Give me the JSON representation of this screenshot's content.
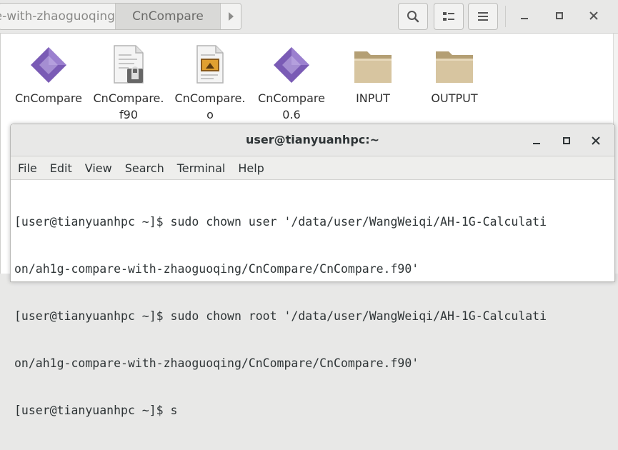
{
  "file_manager": {
    "breadcrumbs": [
      "pare-with-zhaoguoqing",
      "CnCompare"
    ],
    "buttons": [
      "search-icon",
      "view-toggle-icon",
      "menu-icon"
    ],
    "window_controls": [
      "minimize",
      "maximize",
      "close"
    ],
    "files": [
      {
        "name_line1": "CnCompare",
        "name_line2": "",
        "icon": "executable-icon"
      },
      {
        "name_line1": "CnCompare.",
        "name_line2": "f90",
        "icon": "text-file-locked-icon"
      },
      {
        "name_line1": "CnCompare.",
        "name_line2": "o",
        "icon": "object-file-icon"
      },
      {
        "name_line1": "CnCompare",
        "name_line2": "0.6",
        "icon": "executable-icon"
      },
      {
        "name_line1": "INPUT",
        "name_line2": "",
        "icon": "folder-icon"
      },
      {
        "name_line1": "OUTPUT",
        "name_line2": "",
        "icon": "folder-icon"
      }
    ]
  },
  "terminal": {
    "title": "user@tianyuanhpc:~",
    "menu": [
      "File",
      "Edit",
      "View",
      "Search",
      "Terminal",
      "Help"
    ],
    "lines": [
      "[user@tianyuanhpc ~]$ sudo chown user '/data/user/WangWeiqi/AH-1G-Calculati",
      "on/ah1g-compare-with-zhaoguoqing/CnCompare/CnCompare.f90'",
      "[user@tianyuanhpc ~]$ sudo chown root '/data/user/WangWeiqi/AH-1G-Calculati",
      "on/ah1g-compare-with-zhaoguoqing/CnCompare/CnCompare.f90'",
      "[user@tianyuanhpc ~]$ s"
    ]
  },
  "colors": {
    "executable_purple": "#7a5bb5",
    "folder_tan": "#d7c5a0",
    "chrome_bg": "#e8e8e7"
  }
}
